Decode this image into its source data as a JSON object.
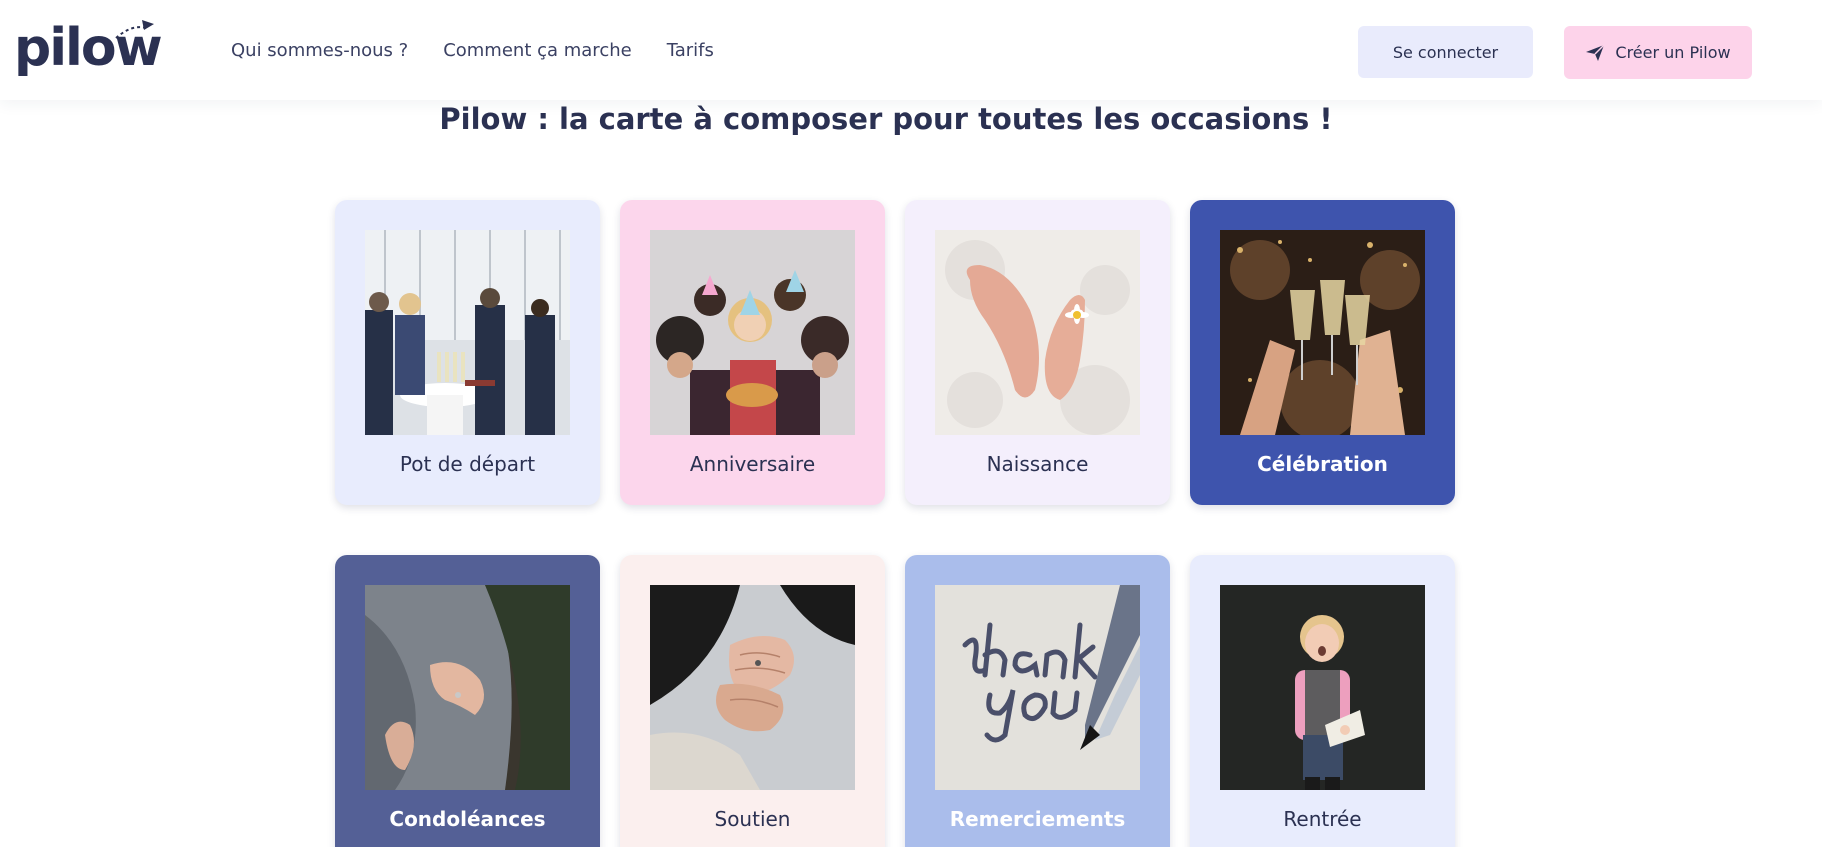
{
  "brand": {
    "logo_text": "pilow"
  },
  "nav": {
    "items": [
      {
        "label": "Qui sommes-nous ?"
      },
      {
        "label": "Comment ça marche"
      },
      {
        "label": "Tarifs"
      }
    ]
  },
  "actions": {
    "login_label": "Se connecter",
    "create_label": "Créer un Pilow"
  },
  "headline": "Pilow : la carte à composer pour toutes les occasions !",
  "occasions": [
    {
      "label": "Pot de départ",
      "bg": "#e8ecfd",
      "photo": "office party"
    },
    {
      "label": "Anniversaire",
      "bg": "#fcd6ec",
      "photo": "birthday cake"
    },
    {
      "label": "Naissance",
      "bg": "#f4effc",
      "photo": "baby feet"
    },
    {
      "label": "Célébration",
      "bg": "#3e54ad",
      "photo": "champagne toast"
    },
    {
      "label": "Condoléances",
      "bg": "#546096",
      "photo": "comforting hug"
    },
    {
      "label": "Soutien",
      "bg": "#fbefee",
      "photo": "holding hands"
    },
    {
      "label": "Remerciements",
      "bg": "#aabdeb",
      "photo": "thank you note"
    },
    {
      "label": "Rentrée",
      "bg": "#e8ecfd",
      "photo": "child with book"
    }
  ]
}
